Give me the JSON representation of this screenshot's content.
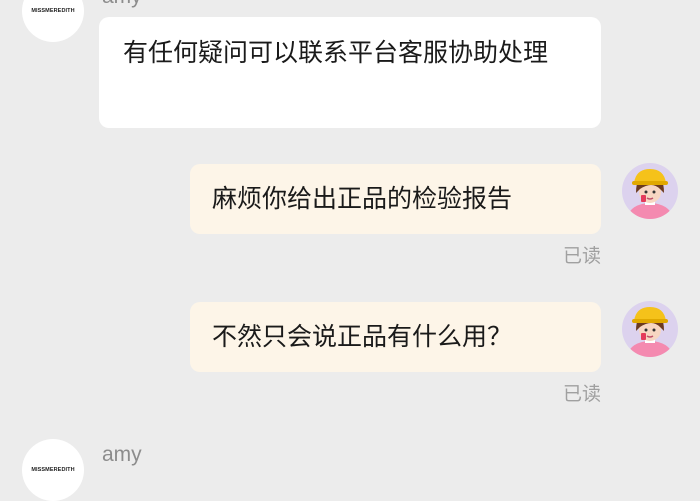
{
  "messages": [
    {
      "sender": "amy",
      "avatar_text": "MISSMEREDITH",
      "text": "有任何疑问可以联系平台客服协助处理"
    },
    {
      "text": "麻烦你给出正品的检验报告",
      "status": "已读",
      "avatar_icon": "cartoon-user-avatar-icon"
    },
    {
      "text": "不然只会说正品有什么用？",
      "status": "已读",
      "avatar_icon": "cartoon-user-avatar-icon"
    },
    {
      "sender": "amy",
      "avatar_text": "MISSMEREDITH"
    }
  ],
  "colors": {
    "background": "#ececec",
    "incoming_bubble": "#ffffff",
    "outgoing_bubble": "#fdf5e8",
    "read_status": "#a0a0a0",
    "sender_name": "#8c8c8c"
  }
}
